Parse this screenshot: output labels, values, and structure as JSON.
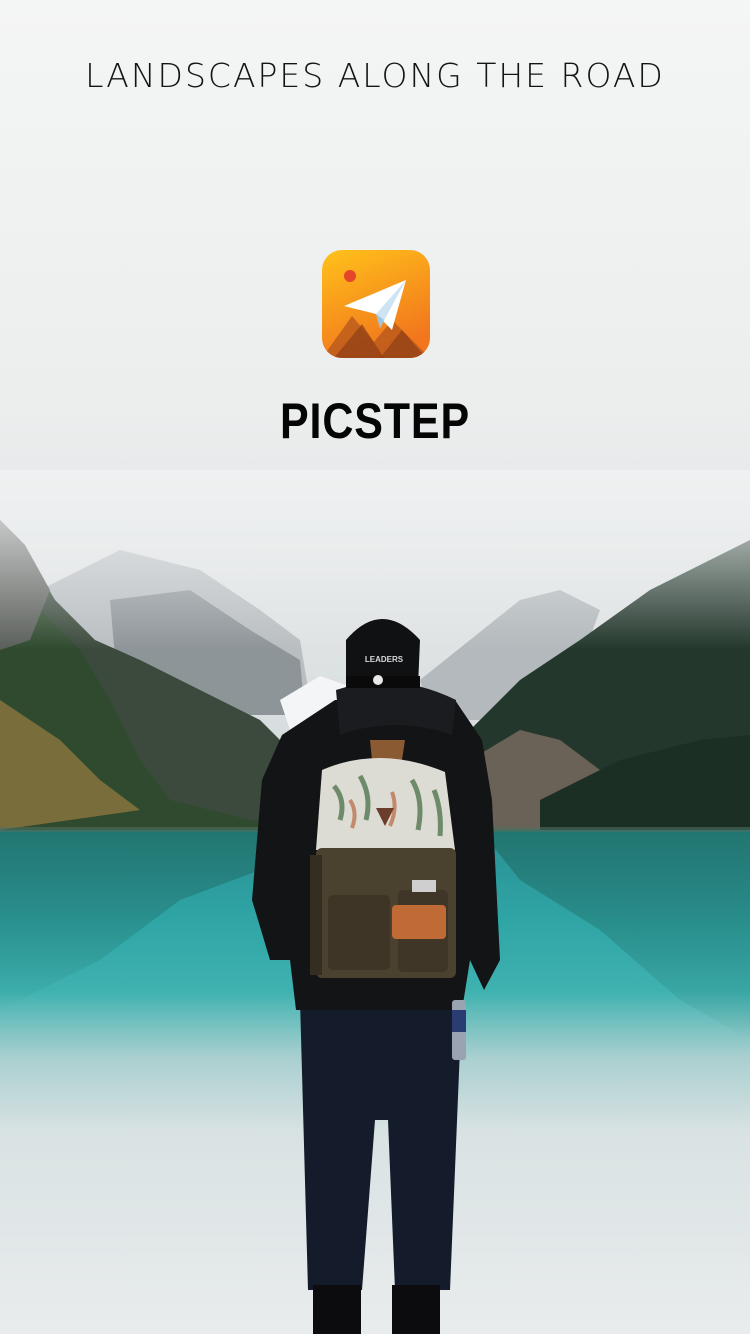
{
  "splash": {
    "tagline": "LANDSCAPES ALONG THE ROAD",
    "app_name": "PICSTEP",
    "app_icon": "paper-plane-mountains-icon"
  },
  "colors": {
    "icon_gradient_top": "#FFC21A",
    "icon_gradient_bottom": "#F2761D",
    "lake": "#2fa3a3",
    "text": "#000000"
  }
}
